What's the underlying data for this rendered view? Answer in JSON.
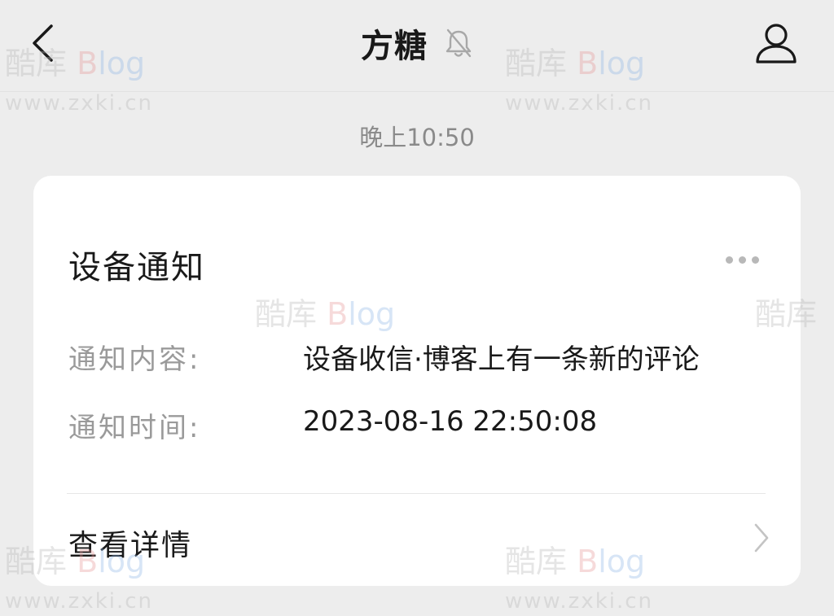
{
  "header": {
    "title": "方糖",
    "back_icon": "chevron-left-icon",
    "mute_icon": "bell-off-icon",
    "profile_icon": "person-icon"
  },
  "timestamp": "晚上10:50",
  "card": {
    "title": "设备通知",
    "more_icon": "more-dots-icon",
    "fields": [
      {
        "label": "通知内容:",
        "value": "设备收信·博客上有一条新的评论"
      },
      {
        "label": "通知时间:",
        "value": "2023-08-16 22:50:08"
      }
    ],
    "details_label": "查看详情",
    "details_icon": "chevron-right-icon"
  },
  "watermark": {
    "logo_cn": "酷库",
    "logo_b": "B",
    "logo_log": "log",
    "url": "www.zxki.cn"
  },
  "colors": {
    "background": "#ededed",
    "card": "#ffffff",
    "primary_text": "#191919",
    "secondary_text": "#9a9a9a"
  }
}
